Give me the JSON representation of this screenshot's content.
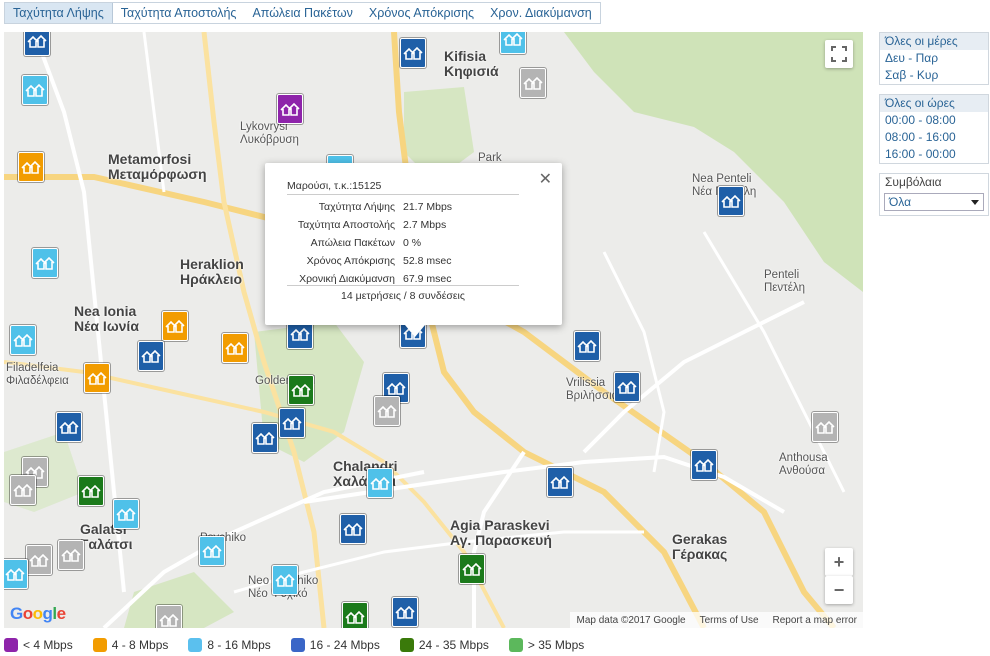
{
  "tabs": [
    {
      "label": "Ταχύτητα Λήψης",
      "active": true
    },
    {
      "label": "Ταχύτητα Αποστολής",
      "active": false
    },
    {
      "label": "Απώλεια Πακέτων",
      "active": false
    },
    {
      "label": "Χρόνος Απόκρισης",
      "active": false
    },
    {
      "label": "Χρον. Διακύμανση",
      "active": false
    }
  ],
  "map": {
    "places": [
      {
        "name": "Kifisia",
        "greek": "Κηφισιά"
      },
      {
        "name": "Metamorfosi",
        "greek": "Μεταμόρφωση"
      },
      {
        "name": "Heraklion",
        "greek": "Ηράκλειο"
      },
      {
        "name": "Nea Ionia",
        "greek": "Νέα Ιωνία"
      },
      {
        "name": "Chalandri",
        "greek": "Χαλάνδρι"
      },
      {
        "name": "Agia Paraskevi",
        "greek": "Αγ. Παρασκευή"
      },
      {
        "name": "Galatsi",
        "greek": "Γαλάτσι"
      },
      {
        "name": "Gerakas",
        "greek": "Γέρακας"
      },
      {
        "name": "Vrilissia",
        "greek": "Βριλήσσια"
      },
      {
        "name": "Nea Penteli",
        "greek": "Νέα Πεντέλη"
      },
      {
        "name": "Penteli",
        "greek": "Πεντέλη"
      },
      {
        "name": "Anthousa",
        "greek": "Ανθούσα"
      },
      {
        "name": "Lykovrysi",
        "greek": "Λυκόβρυση"
      },
      {
        "name": "Filadelfeia",
        "greek": "Φιλαδέλφεια"
      },
      {
        "name": "Psychiko",
        "greek": ""
      },
      {
        "name": "Neo Psychiko",
        "greek": "Νέο Ψυχικό"
      },
      {
        "name": "Park",
        "greek": ""
      },
      {
        "name": "Golden Hall",
        "greek": ""
      }
    ],
    "attribution": [
      "Map data ©2017 Google",
      "Terms of Use",
      "Report a map error"
    ],
    "logo": "Google",
    "zoom_in": "+",
    "zoom_out": "−"
  },
  "popup": {
    "title": "Μαρούσι, τ.κ.:15125",
    "rows": [
      {
        "label": "Ταχύτητα Λήψης",
        "value": "21.7 Mbps"
      },
      {
        "label": "Ταχύτητα Αποστολής",
        "value": "2.7 Mbps"
      },
      {
        "label": "Απώλεια Πακέτων",
        "value": "0 %"
      },
      {
        "label": "Χρόνος Απόκρισης",
        "value": "52.8 msec"
      },
      {
        "label": "Χρονική Διακύμανση",
        "value": "67.9 msec"
      }
    ],
    "footer": "14 μετρήσεις / 8 συνδέσεις",
    "close": "✕"
  },
  "filters": {
    "days": {
      "header": "Όλες οι μέρες",
      "items": [
        "Δευ - Παρ",
        "Σαβ - Κυρ"
      ]
    },
    "hours": {
      "header": "Όλες οι ώρες",
      "items": [
        "00:00 - 08:00",
        "08:00 - 16:00",
        "16:00 - 00:00"
      ]
    },
    "contracts": {
      "header": "Συμβόλαια",
      "selected": "Όλα"
    }
  },
  "legend": [
    {
      "label": "< 4 Mbps",
      "color": "#8e24aa"
    },
    {
      "label": "4 - 8 Mbps",
      "color": "#f29c00"
    },
    {
      "label": "8 - 16 Mbps",
      "color": "#5bc0ee"
    },
    {
      "label": "16 - 24 Mbps",
      "color": "#3a66c7"
    },
    {
      "label": "24 - 35 Mbps",
      "color": "#3a7a0a"
    },
    {
      "label": "> 35 Mbps",
      "color": "#5cb85c"
    }
  ]
}
